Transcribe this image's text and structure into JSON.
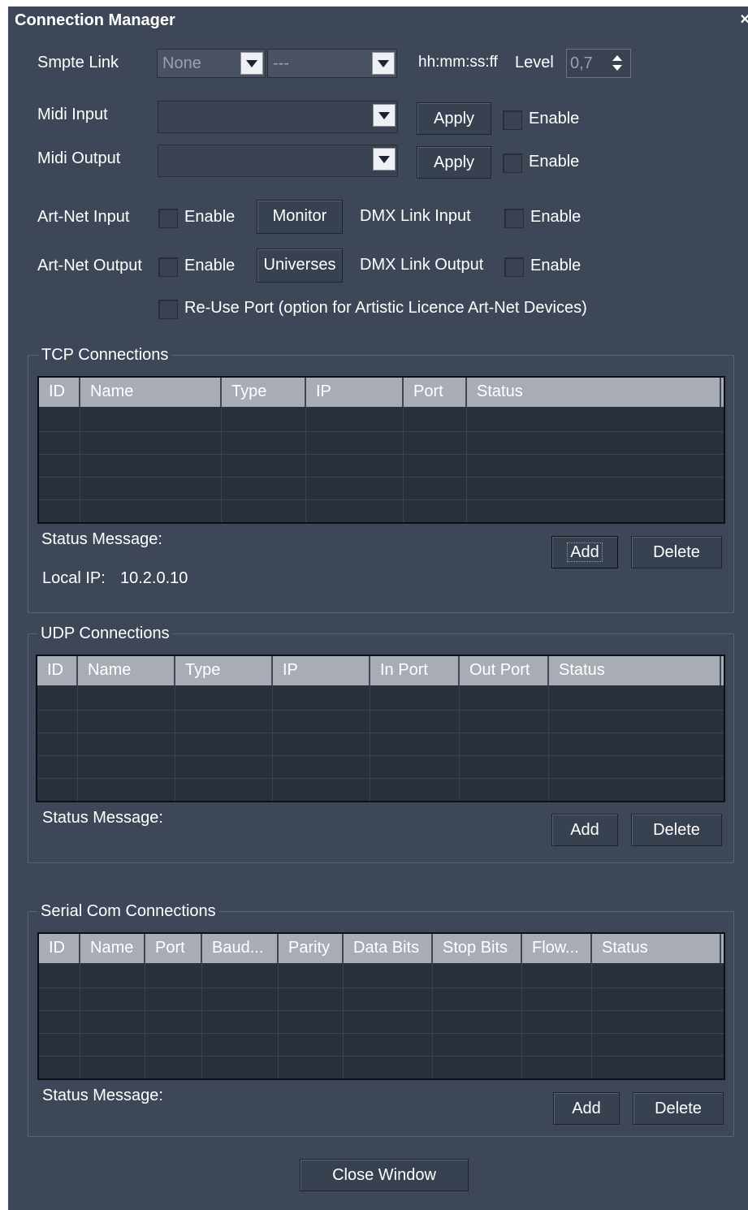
{
  "window": {
    "title": "Connection Manager",
    "close_glyph": "×"
  },
  "smpte": {
    "label": "Smpte Link",
    "source_value": "None",
    "second_value": "---",
    "format_label": "hh:mm:ss:ff",
    "level_label": "Level",
    "level_value": "0,7"
  },
  "midi_input": {
    "label": "Midi Input",
    "value": "",
    "apply_label": "Apply",
    "enable_label": "Enable"
  },
  "midi_output": {
    "label": "Midi Output",
    "value": "",
    "apply_label": "Apply",
    "enable_label": "Enable"
  },
  "artnet_input": {
    "label": "Art-Net Input",
    "enable_label": "Enable",
    "button_label": "Monitor",
    "dmx_label": "DMX Link Input",
    "dmx_enable_label": "Enable"
  },
  "artnet_output": {
    "label": "Art-Net Output",
    "enable_label": "Enable",
    "button_label": "Universes",
    "dmx_label": "DMX Link Output",
    "dmx_enable_label": "Enable"
  },
  "reuse_port": {
    "label": "Re-Use Port (option for Artistic Licence Art-Net Devices)"
  },
  "tcp": {
    "title": "TCP Connections",
    "columns": [
      "ID",
      "Name",
      "Type",
      "IP",
      "Port",
      "Status"
    ],
    "status_label": "Status Message:",
    "local_ip_label": "Local IP:",
    "local_ip_value": "10.2.0.10",
    "add_label": "Add",
    "delete_label": "Delete"
  },
  "udp": {
    "title": "UDP Connections",
    "columns": [
      "ID",
      "Name",
      "Type",
      "IP",
      "In Port",
      "Out Port",
      "Status"
    ],
    "status_label": "Status Message:",
    "add_label": "Add",
    "delete_label": "Delete"
  },
  "serial": {
    "title": "Serial Com Connections",
    "columns": [
      "ID",
      "Name",
      "Port",
      "Baud...",
      "Parity",
      "Data Bits",
      "Stop Bits",
      "Flow...",
      "Status"
    ],
    "status_label": "Status Message:",
    "add_label": "Add",
    "delete_label": "Delete"
  },
  "footer": {
    "close_label": "Close Window"
  },
  "colors": {
    "window_bg": "#3e4757",
    "grid_bg": "#2a313d",
    "header_bg": "#a7acb5",
    "focus_ring": "#ff6a6a"
  }
}
